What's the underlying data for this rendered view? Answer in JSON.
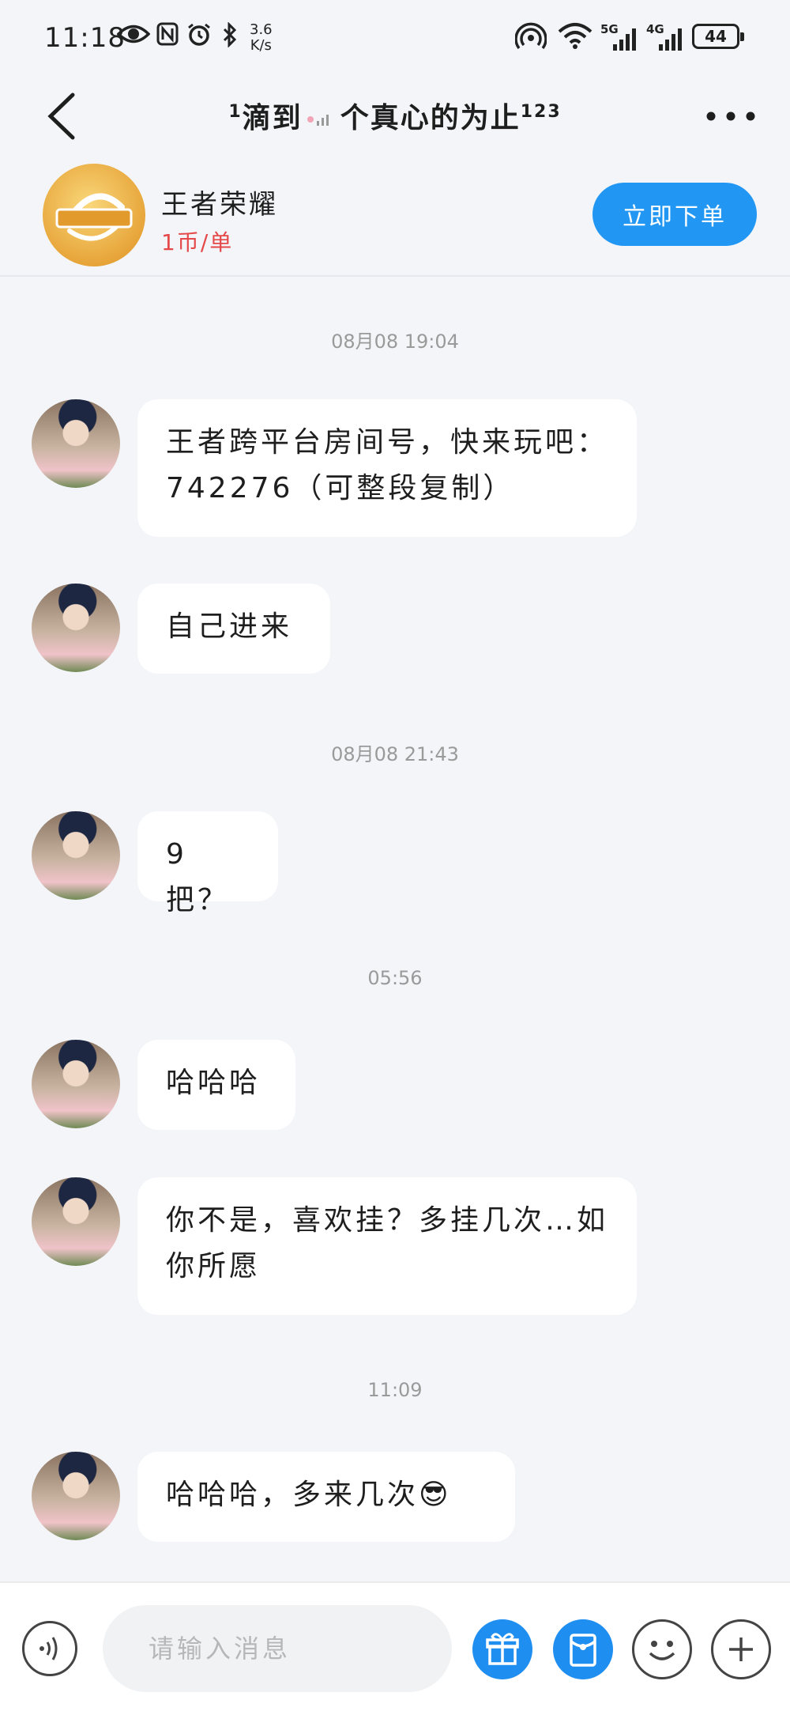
{
  "status_bar": {
    "time": "11:18",
    "speed_value": "3.6",
    "speed_unit": "K/s",
    "network_1": "5G",
    "network_2": "4G",
    "battery": "44"
  },
  "header": {
    "title_prefix_sup": "1",
    "title_main": "滴到",
    "title_main_2": "个真心的为止",
    "title_suffix_sup": "123"
  },
  "service": {
    "name": "王者荣耀",
    "price": "1币/单",
    "order_button": "立即下单"
  },
  "messages": [
    {
      "timestamp": "08月08  19:04",
      "text": "王者跨平台房间号，快来玩吧：742276（可整段复制）"
    },
    {
      "text": "自己进来"
    },
    {
      "timestamp": "08月08  21:43",
      "text": "9把？"
    },
    {
      "timestamp": "05:56",
      "text": "哈哈哈"
    },
    {
      "text": "你不是，喜欢挂？多挂几次…如你所愿"
    },
    {
      "timestamp": "11:09",
      "text": "哈哈哈，多来几次😎"
    }
  ],
  "input_bar": {
    "placeholder": "请输入消息"
  },
  "colors": {
    "accent_blue": "#2196f3",
    "price_red": "#e54848",
    "background": "#f3f5f9"
  }
}
